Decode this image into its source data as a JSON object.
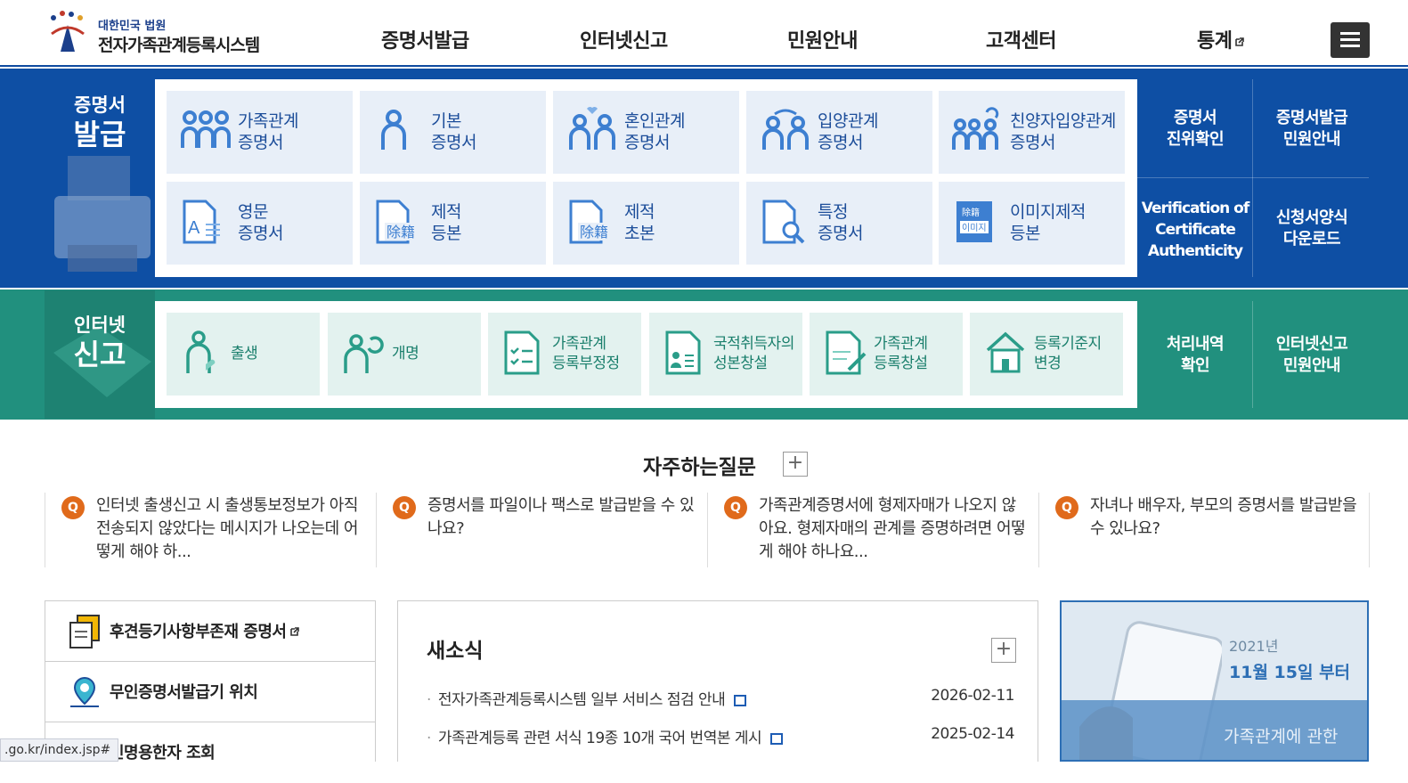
{
  "header": {
    "court": "대한민국 법원",
    "system": "전자가족관계등록시스템",
    "nav": [
      "증명서발급",
      "인터넷신고",
      "민원안내",
      "고객센터",
      "통계"
    ]
  },
  "cert": {
    "title1": "증명서",
    "title2": "발급",
    "cards": [
      {
        "l1": "가족관계",
        "l2": "증명서"
      },
      {
        "l1": "기본",
        "l2": "증명서"
      },
      {
        "l1": "혼인관계",
        "l2": "증명서"
      },
      {
        "l1": "입양관계",
        "l2": "증명서"
      },
      {
        "l1": "친양자입양관계",
        "l2": "증명서"
      },
      {
        "l1": "영문",
        "l2": "증명서"
      },
      {
        "l1": "제적",
        "l2": "등본"
      },
      {
        "l1": "제적",
        "l2": "초본"
      },
      {
        "l1": "특정",
        "l2": "증명서"
      },
      {
        "l1": "이미지제적",
        "l2": "등본"
      }
    ],
    "quick": [
      {
        "l1": "증명서",
        "l2": "진위확인"
      },
      {
        "l1": "증명서발급",
        "l2": "민원안내"
      },
      {
        "l1": "Verification of",
        "l2": "Certificate",
        "l3": "Authenticity"
      },
      {
        "l1": "신청서양식",
        "l2": "다운로드"
      }
    ],
    "icon_text": {
      "jejeok": "除籍",
      "image": "이미지"
    }
  },
  "report": {
    "title1": "인터넷",
    "title2": "신고",
    "cards": [
      {
        "l1": "출생",
        "l2": ""
      },
      {
        "l1": "개명",
        "l2": ""
      },
      {
        "l1": "가족관계",
        "l2": "등록부정정"
      },
      {
        "l1": "국적취득자의",
        "l2": "성본창설"
      },
      {
        "l1": "가족관계",
        "l2": "등록창설"
      },
      {
        "l1": "등록기준지",
        "l2": "변경"
      }
    ],
    "quick": [
      {
        "l1": "처리내역",
        "l2": "확인"
      },
      {
        "l1": "인터넷신고",
        "l2": "민원안내"
      }
    ]
  },
  "faq": {
    "title": "자주하는질문",
    "q_mark": "Q",
    "items": [
      "인터넷 출생신고 시 출생통보정보가 아직 전송되지 않았다는 메시지가 나오는데 어떻게 해야 하...",
      "증명서를 파일이나 팩스로 발급받을 수 있나요?",
      "가족관계증명서에 형제자매가 나오지 않아요. 형제자매의 관계를 증명하려면 어떻게 해야 하나요...",
      "자녀나 배우자, 부모의 증명서를 발급받을 수 있나요?"
    ]
  },
  "links": [
    "후견등기사항부존재 증명서",
    "무인증명서발급기 위치",
    "인명용한자 조회"
  ],
  "news": {
    "title": "새소식",
    "items": [
      {
        "text": "전자가족관계등록시스템 일부 서비스 점검 안내",
        "date": "2026-02-11"
      },
      {
        "text": "가족관계등록 관련 서식 19종 10개 국어 번역본 게시",
        "date": "2025-02-14"
      }
    ]
  },
  "banner": {
    "year": "2021년",
    "date": "11월 15일 부터",
    "text": "가족관계에 관한"
  },
  "status_url": ".go.kr/index.jsp#",
  "colors": {
    "blue": "#0e4fa4",
    "green": "#21907e",
    "accent": "#e06a1b"
  }
}
